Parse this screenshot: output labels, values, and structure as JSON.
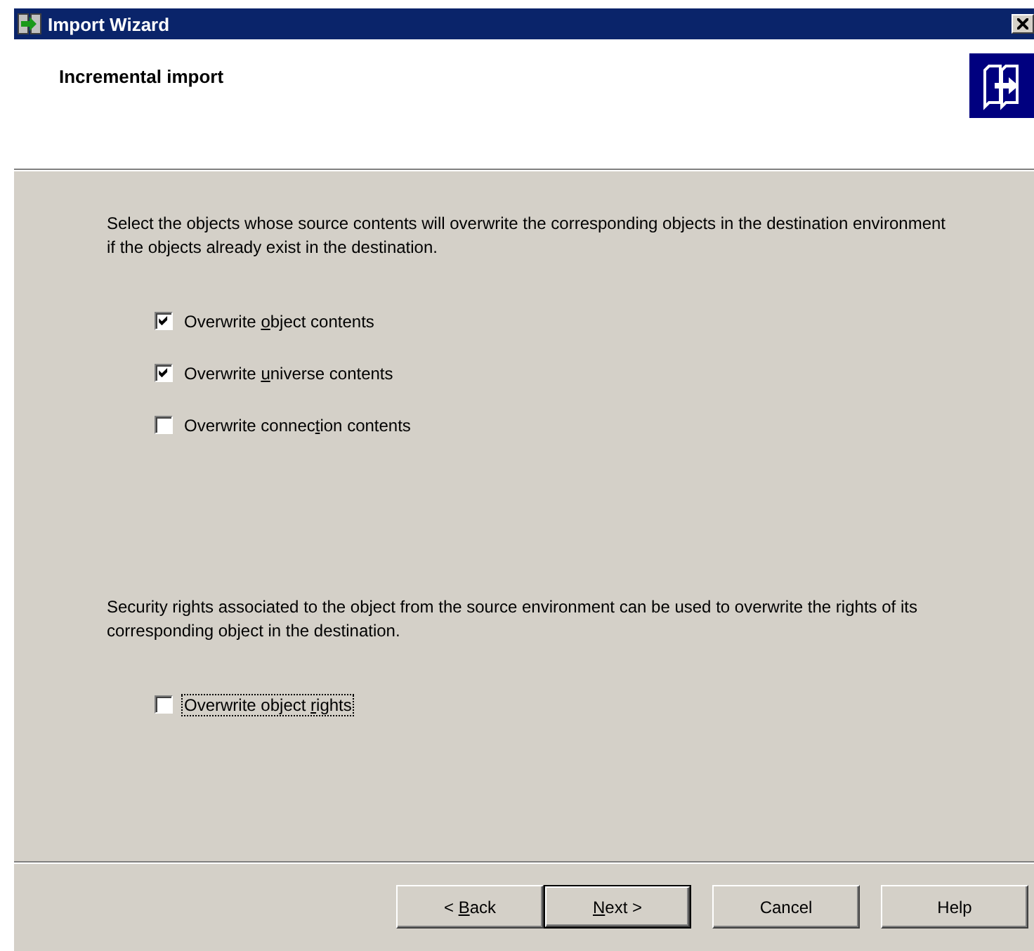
{
  "window": {
    "title": "Import Wizard"
  },
  "header": {
    "title": "Incremental import"
  },
  "sections": [
    {
      "text": "Select the objects whose source contents will overwrite the corresponding objects in the destination environment if the objects already exist in the destination.",
      "options": [
        {
          "label": {
            "before": "Overwrite ",
            "key": "o",
            "after": "bject contents"
          },
          "checked": true,
          "focused": false
        },
        {
          "label": {
            "before": "Overwrite ",
            "key": "u",
            "after": "niverse contents"
          },
          "checked": true,
          "focused": false
        },
        {
          "label": {
            "before": "Overwrite connec",
            "key": "t",
            "after": "ion contents"
          },
          "checked": false,
          "focused": false
        }
      ]
    },
    {
      "text": "Security rights associated to the object from the source environment can be used to overwrite the rights of its corresponding object in the destination.",
      "options": [
        {
          "label": {
            "before": "Overwrite object ",
            "key": "r",
            "after": "ights"
          },
          "checked": false,
          "focused": true
        }
      ]
    }
  ],
  "buttons": [
    {
      "label": {
        "before": "< ",
        "key": "B",
        "after": "ack"
      },
      "default": false
    },
    {
      "label": {
        "key": "N",
        "after": "ext >"
      },
      "default": true
    },
    {
      "label": {
        "before": "Cancel"
      },
      "default": false
    },
    {
      "label": {
        "before": "Help"
      },
      "default": false
    }
  ]
}
